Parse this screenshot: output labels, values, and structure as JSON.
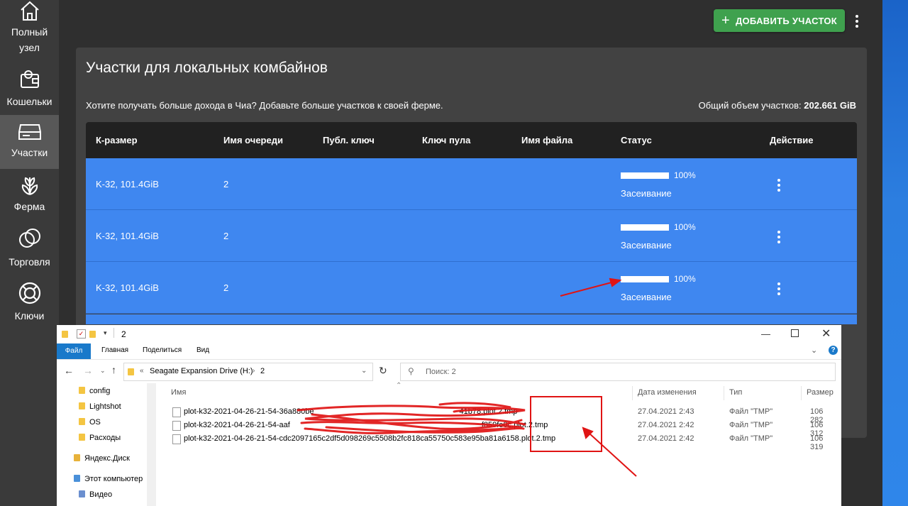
{
  "sidebar": {
    "items": [
      {
        "label": "Полный узел",
        "icon": "home-icon"
      },
      {
        "label": "Кошельки",
        "icon": "wallet-icon"
      },
      {
        "label": "Участки",
        "icon": "hard-drive-icon"
      },
      {
        "label": "Ферма",
        "icon": "plant-icon"
      },
      {
        "label": "Торговля",
        "icon": "trade-circles-icon"
      },
      {
        "label": "Ключи",
        "icon": "lifebuoy-icon"
      }
    ]
  },
  "header": {
    "add_button_label": "ДОБАВИТЬ УЧАСТОК"
  },
  "card": {
    "title": "Участки для локальных комбайнов",
    "subtitle": "Хотите получать больше дохода в Чиа? Добавьте больше участков к своей ферме.",
    "total_label": "Общий объем участков:",
    "total_value": "202.661 GiB"
  },
  "table": {
    "columns": [
      "К-размер",
      "Имя очереди",
      "Публ. ключ",
      "Ключ пула",
      "Имя файла",
      "Статус",
      "Действие"
    ],
    "rows": [
      {
        "size": "K-32, 101.4GiB",
        "queue": "2",
        "progress": 100,
        "percent": "100%",
        "status": "Засеивание"
      },
      {
        "size": "K-32, 101.4GiB",
        "queue": "2",
        "progress": 100,
        "percent": "100%",
        "status": "Засеивание"
      },
      {
        "size": "K-32, 101.4GiB",
        "queue": "2",
        "progress": 100,
        "percent": "100%",
        "status": "Засеивание"
      }
    ]
  },
  "explorer": {
    "title": "2",
    "ribbon_tabs": [
      "Файл",
      "Главная",
      "Поделиться",
      "Вид"
    ],
    "address": {
      "drive": "Seagate Expansion Drive (H:)",
      "folder": "2"
    },
    "search_placeholder": "Поиск: 2",
    "tree": [
      "config",
      "Lightshot",
      "OS",
      "Расходы",
      "Яндекс.Диск",
      "Этот компьютер",
      "Видео"
    ],
    "columns": [
      "Имя",
      "Дата изменения",
      "Тип",
      "Размер"
    ],
    "files": [
      {
        "name_start": "plot-k32-2021-04-26-21-54-36a880be",
        "name_end": "41b78.plot.2.tmp",
        "date": "27.04.2021 2:43",
        "type": "Файл \"TMP\"",
        "size": "106 282"
      },
      {
        "name_start": "plot-k32-2021-04-26-21-54-aaf",
        "name_end": "f859fe0c.plot.2.tmp",
        "date": "27.04.2021 2:42",
        "type": "Файл \"TMP\"",
        "size": "106 312"
      },
      {
        "name_start": "plot-k32-2021-04-26-21-54-cdc2097165c2df5d098269c5508b2fc818ca55750",
        "name_end": "c583e95ba81a6158.plot.2.tmp",
        "date": "27.04.2021 2:42",
        "type": "Файл \"TMP\"",
        "size": "106 319"
      }
    ]
  },
  "colors": {
    "row_blue": "#3f87f0",
    "add_green": "#3fa14e",
    "annotation_red": "#e01414"
  }
}
